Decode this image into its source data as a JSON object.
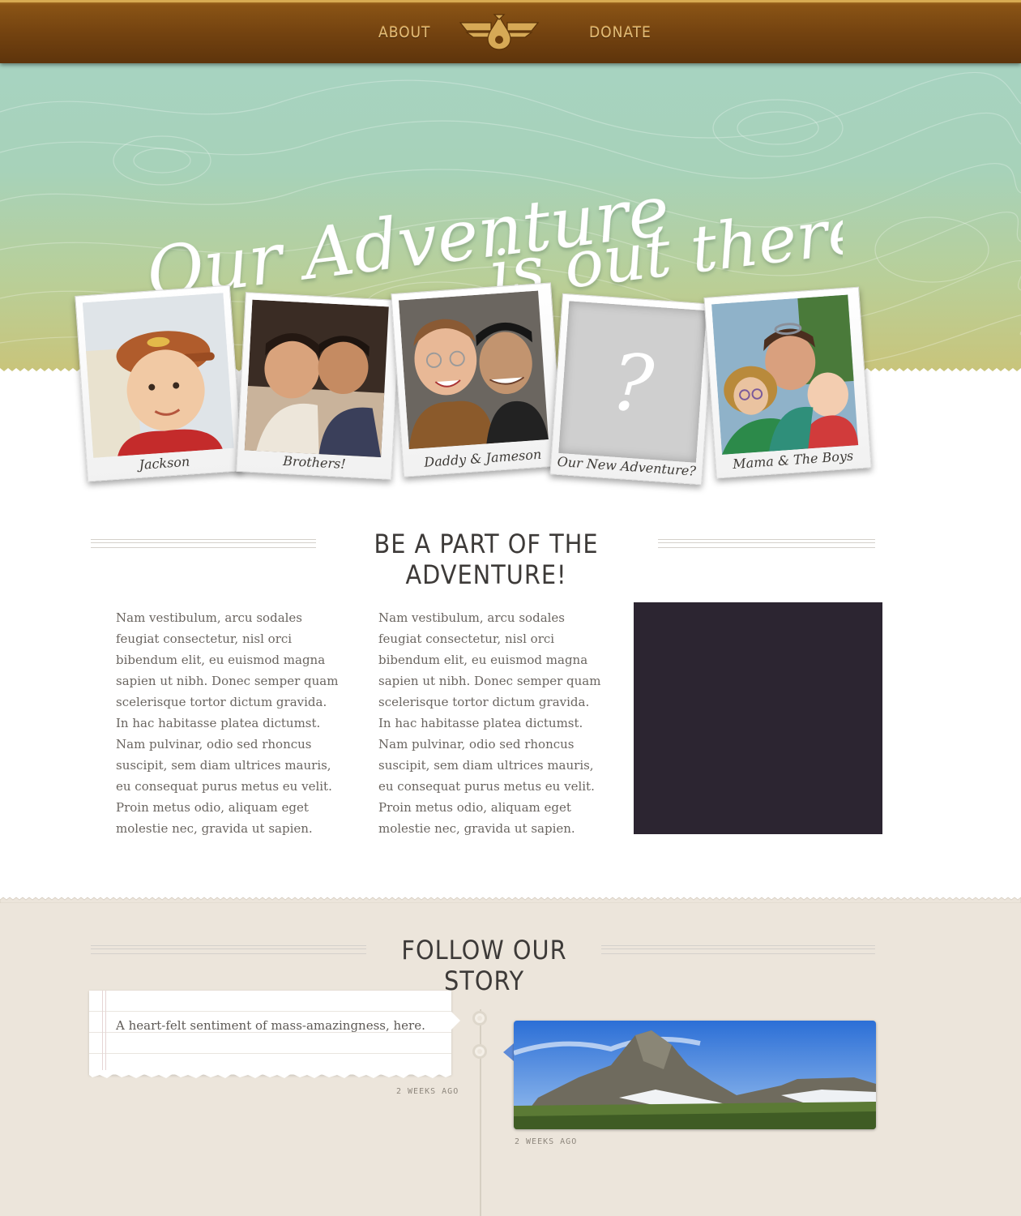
{
  "nav": {
    "about_label": "ABOUT",
    "donate_label": "DONATE"
  },
  "hero": {
    "headline_line1": "Our Adventure",
    "headline_line2": "is out there!"
  },
  "polaroids": [
    {
      "caption": "Jackson"
    },
    {
      "caption": "Brothers!"
    },
    {
      "caption": "Daddy & Jameson"
    },
    {
      "caption": "Our New Adventure?",
      "placeholder": "?"
    },
    {
      "caption": "Mama & The Boys"
    }
  ],
  "adventure": {
    "title": "BE A PART OF THE ADVENTURE!",
    "column1": "Nam vestibulum, arcu sodales feugiat consectetur, nisl orci bibendum elit, eu euismod magna sapien ut nibh. Donec semper quam scelerisque tortor dictum gravida. In hac habitasse platea dictumst. Nam pulvinar, odio sed rhoncus suscipit, sem diam ultrices mauris, eu consequat purus metus eu velit. Proin metus odio, aliquam eget molestie nec, gravida ut sapien.",
    "column2": "Nam vestibulum, arcu sodales feugiat consectetur, nisl orci bibendum elit, eu euismod magna sapien ut nibh. Donec semper quam scelerisque tortor dictum gravida. In hac habitasse platea dictumst. Nam pulvinar, odio sed rhoncus suscipit, sem diam ultrices mauris, eu consequat purus metus eu velit. Proin metus odio, aliquam eget molestie nec, gravida ut sapien."
  },
  "story": {
    "title": "FOLLOW OUR STORY",
    "posts": [
      {
        "text": "A heart-felt sentiment of mass-amazingness, here.",
        "time": "2 WEEKS AGO"
      },
      {
        "time": "2 WEEKS AGO"
      }
    ]
  },
  "colors": {
    "nav_brown": "#744310",
    "nav_gold": "#e2bc78",
    "video_bg": "#2c2531",
    "story_bg": "#ece5db"
  },
  "icons": [
    "winged-drop-logo-icon"
  ]
}
